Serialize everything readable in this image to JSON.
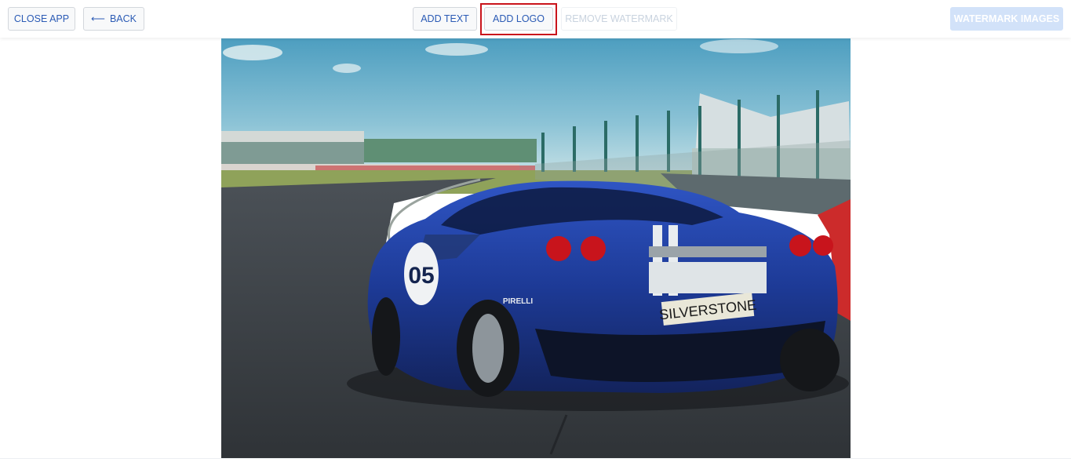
{
  "toolbar": {
    "close_label": "CLOSE APP",
    "back_label": "BACK",
    "back_icon": "arrow-left-icon",
    "add_text_label": "ADD TEXT",
    "add_logo_label": "ADD LOGO",
    "remove_watermark_label": "REMOVE WATERMARK",
    "watermark_images_label": "WATERMARK IMAGES"
  },
  "image": {
    "plate_text": "SILVERSTONE",
    "car_number": "05",
    "sponsor_text": "PIRELLI"
  },
  "colors": {
    "accent": "#2b5bb5",
    "highlight": "#c9141b",
    "primary_disabled": "#d2e2f9",
    "car_body": "#1f3a8f"
  }
}
